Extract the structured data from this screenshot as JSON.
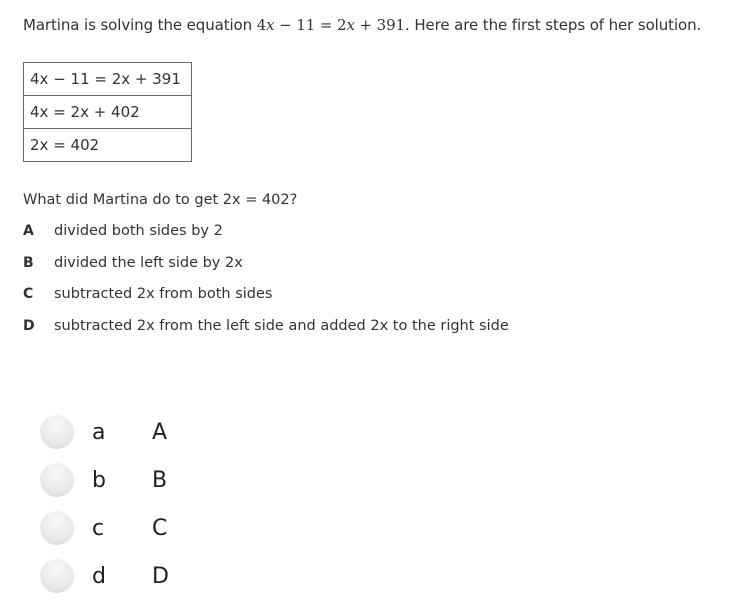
{
  "prompt": {
    "before": "Martina is solving the equation ",
    "equation_parts": [
      "4",
      "x",
      " − 11 = 2",
      "x",
      " + 391"
    ],
    "after": ". Here are the first steps of her solution."
  },
  "steps_table": [
    "4x − 11 = 2x + 391",
    "4x = 2x + 402",
    "2x = 402"
  ],
  "question": "What did Martina do to get 2x = 402?",
  "choices": [
    {
      "letter": "A",
      "text": "divided both sides by 2"
    },
    {
      "letter": "B",
      "text": "divided the left side by 2x"
    },
    {
      "letter": "C",
      "text": "subtracted 2x from both sides"
    },
    {
      "letter": "D",
      "text": "subtracted 2x from the left side and added 2x to the right side"
    }
  ],
  "answer_options": [
    {
      "key": "a",
      "value": "A",
      "selected": false
    },
    {
      "key": "b",
      "value": "B",
      "selected": false
    },
    {
      "key": "c",
      "value": "C",
      "selected": false
    },
    {
      "key": "d",
      "value": "D",
      "selected": false
    }
  ]
}
